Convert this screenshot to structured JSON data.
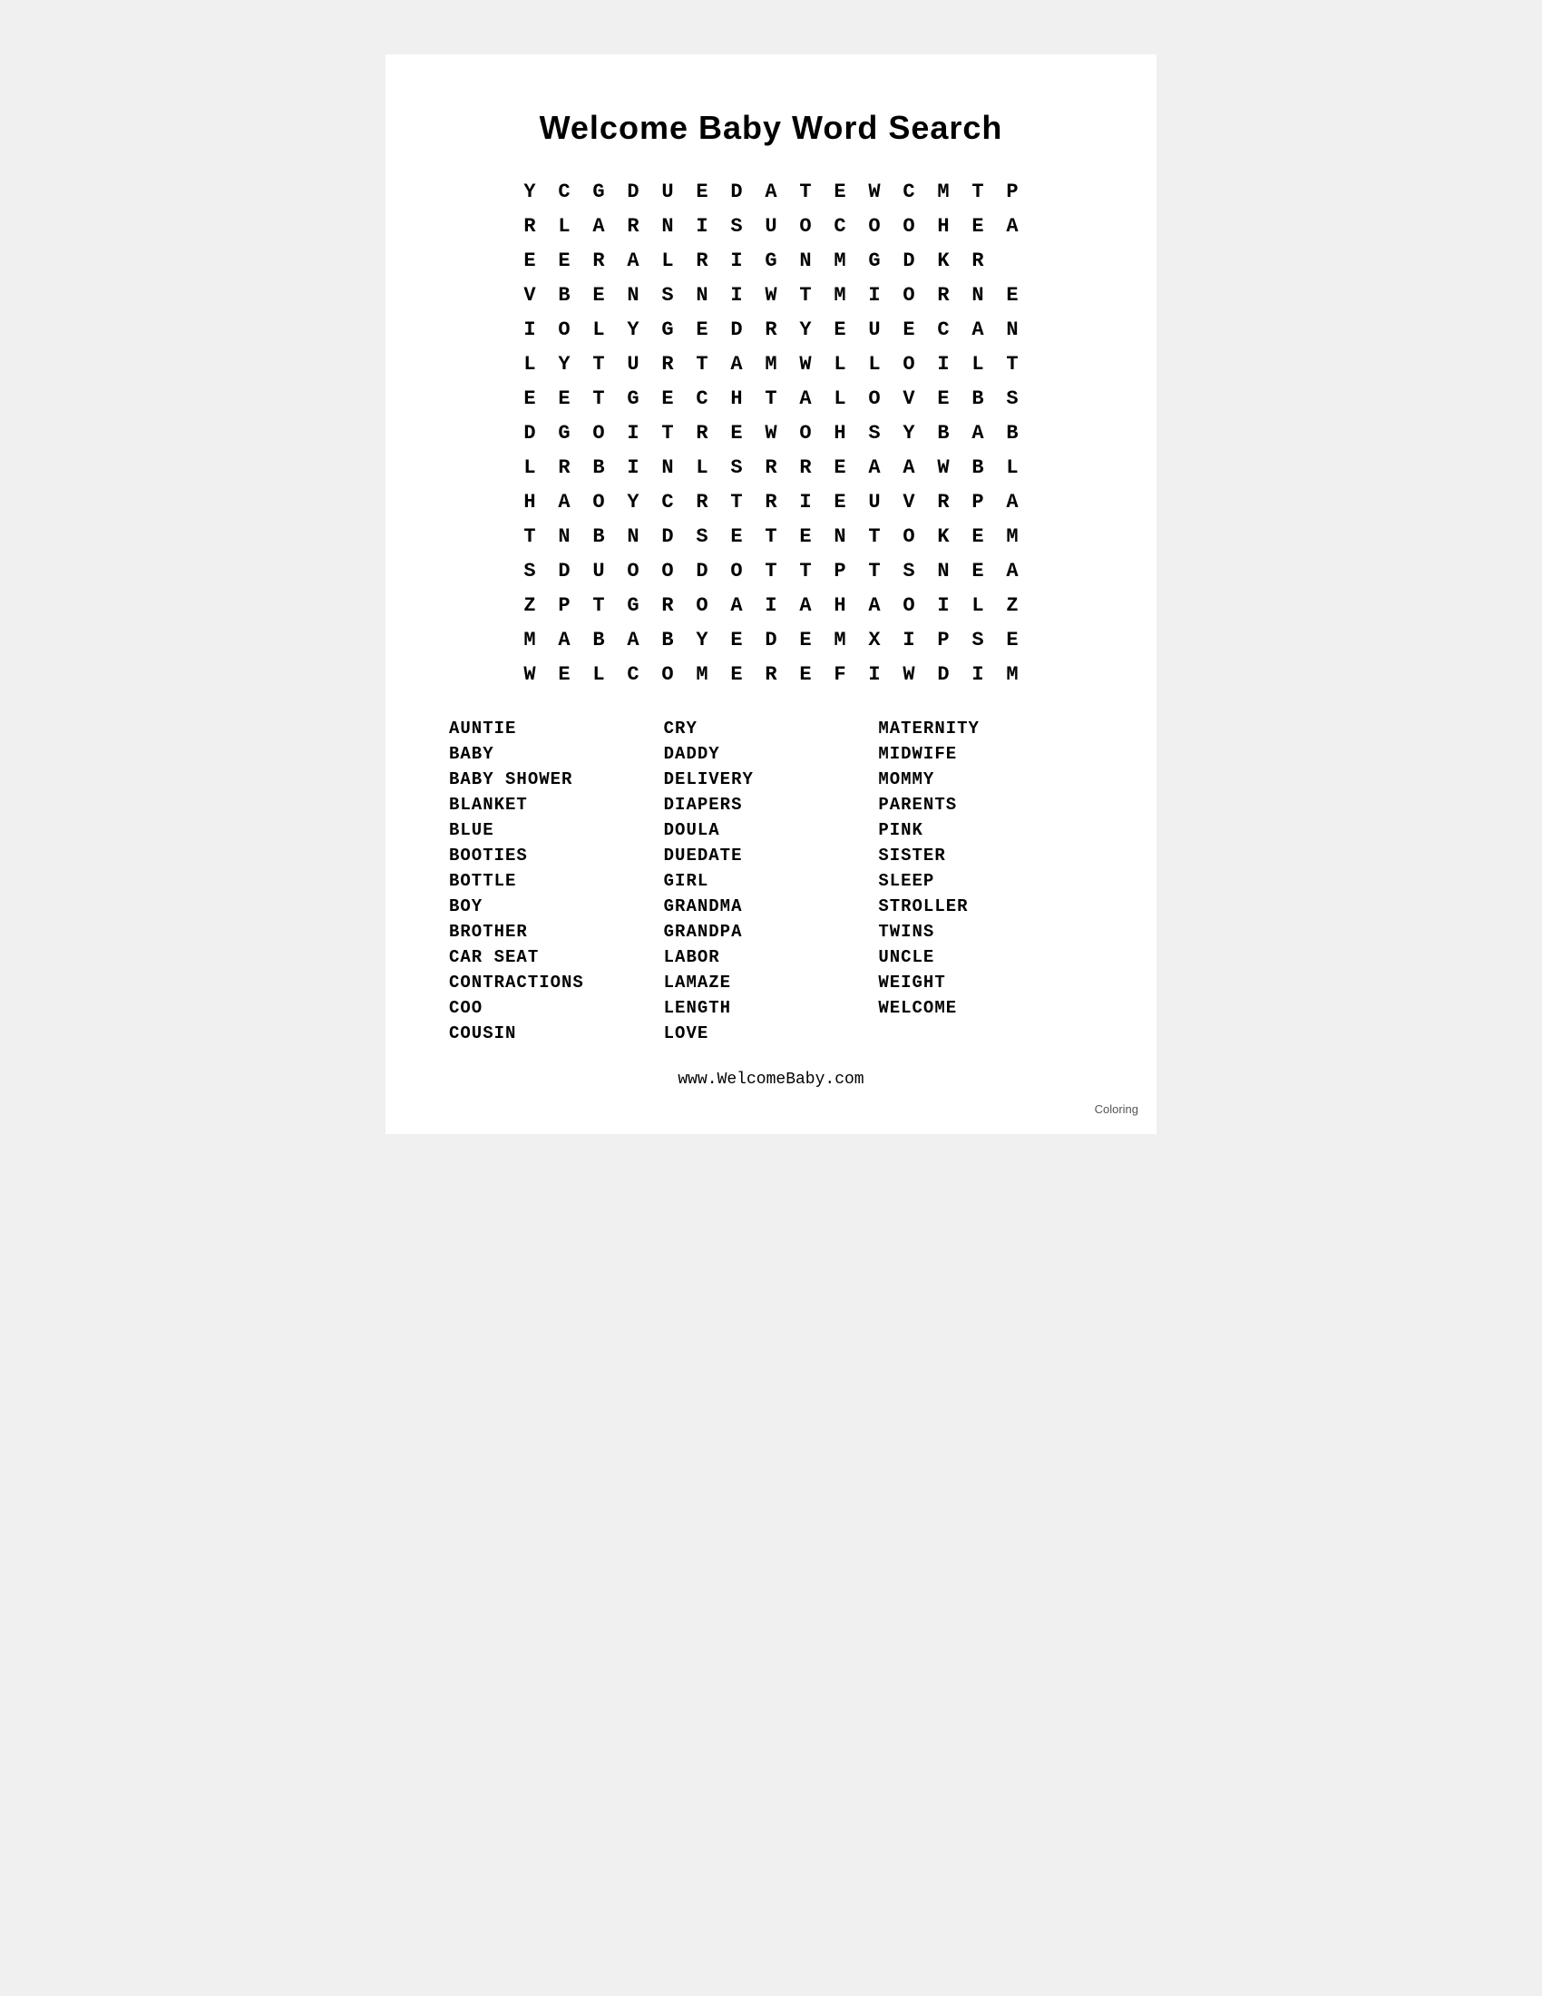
{
  "title": "Welcome Baby Word Search",
  "grid": [
    [
      "Y",
      "C",
      "G",
      "D",
      "U",
      "E",
      "D",
      "A",
      "T",
      "E",
      "W",
      "C",
      "M",
      "T",
      "P"
    ],
    [
      "R",
      "L",
      "A",
      "R",
      "N",
      "I",
      "S",
      "U",
      "O",
      "C",
      "O",
      "O",
      "H",
      "E",
      "A"
    ],
    [
      "E",
      "E",
      "R",
      "A",
      "L",
      "R",
      "I",
      "G",
      "N",
      "M",
      "G",
      "D",
      "K",
      "R",
      ""
    ],
    [
      "V",
      "B",
      "E",
      "N",
      "S",
      "N",
      "I",
      "W",
      "T",
      "M",
      "I",
      "O",
      "R",
      "N",
      "E"
    ],
    [
      "I",
      "O",
      "L",
      "Y",
      "G",
      "E",
      "D",
      "R",
      "Y",
      "E",
      "U",
      "E",
      "C",
      "A",
      "N"
    ],
    [
      "L",
      "Y",
      "T",
      "U",
      "R",
      "T",
      "A",
      "M",
      "W",
      "L",
      "L",
      "O",
      "I",
      "L",
      "T"
    ],
    [
      "E",
      "E",
      "T",
      "G",
      "E",
      "C",
      "H",
      "T",
      "A",
      "L",
      "O",
      "V",
      "E",
      "B",
      "S"
    ],
    [
      "D",
      "G",
      "O",
      "I",
      "T",
      "R",
      "E",
      "W",
      "O",
      "H",
      "S",
      "Y",
      "B",
      "A",
      "B"
    ],
    [
      "L",
      "R",
      "B",
      "I",
      "N",
      "L",
      "S",
      "R",
      "R",
      "E",
      "A",
      "A",
      "W",
      "B",
      "L"
    ],
    [
      "H",
      "A",
      "O",
      "Y",
      "C",
      "R",
      "T",
      "R",
      "I",
      "E",
      "U",
      "V",
      "R",
      "P",
      "A"
    ],
    [
      "T",
      "N",
      "B",
      "N",
      "D",
      "S",
      "E",
      "T",
      "E",
      "N",
      "T",
      "O",
      "K",
      "E",
      "M"
    ],
    [
      "S",
      "D",
      "U",
      "O",
      "O",
      "D",
      "O",
      "T",
      "T",
      "P",
      "T",
      "S",
      "N",
      "E",
      "A"
    ],
    [
      "Z",
      "P",
      "T",
      "G",
      "R",
      "O",
      "A",
      "I",
      "A",
      "H",
      "A",
      "O",
      "I",
      "L",
      "Z"
    ],
    [
      "M",
      "A",
      "B",
      "A",
      "B",
      "Y",
      "E",
      "D",
      "E",
      "M",
      "X",
      "I",
      "P",
      "S",
      "E"
    ],
    [
      "W",
      "E",
      "L",
      "C",
      "O",
      "M",
      "E",
      "R",
      "E",
      "F",
      "I",
      "W",
      "D",
      "I",
      "M"
    ]
  ],
  "words": {
    "column1": [
      "AUNTIE",
      "BABY",
      "BABY SHOWER",
      "BLANKET",
      "BLUE",
      "BOOTIES",
      "BOTTLE",
      "BOY",
      "BROTHER",
      "CAR SEAT",
      "CONTRACTIONS",
      "COO",
      "COUSIN"
    ],
    "column2": [
      "CRY",
      "DADDY",
      "DELIVERY",
      "DIAPERS",
      "DOULA",
      "DUEDATE",
      "GIRL",
      "GRANDMA",
      "GRANDPA",
      "LABOR",
      "LAMAZE",
      "LENGTH",
      "LOVE"
    ],
    "column3": [
      "MATERNITY",
      "MIDWIFE",
      "MOMMY",
      "PARENTS",
      "PINK",
      "SISTER",
      "SLEEP",
      "STROLLER",
      "TWINS",
      "UNCLE",
      "WEIGHT",
      "WELCOME"
    ]
  },
  "footer": "www.WelcomeBaby.com",
  "coloring_label": "Coloring"
}
